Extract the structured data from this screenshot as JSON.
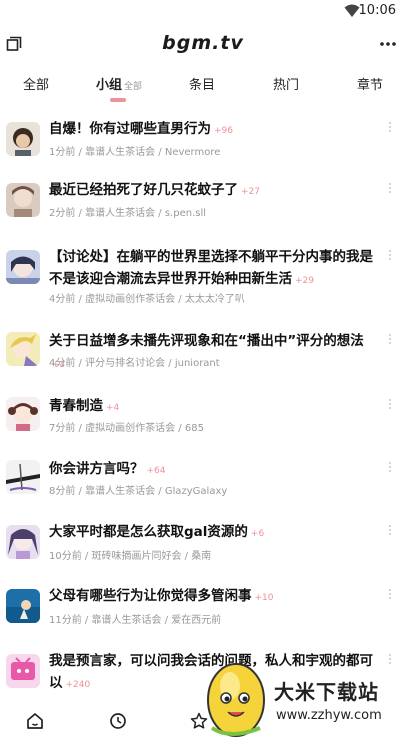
{
  "status_bar": {
    "time": "10:06"
  },
  "app_bar": {
    "logo": "bgm.tv",
    "menu_icon": "menu-list-icon",
    "more_icon": "more-horizontal-icon"
  },
  "tabs": [
    {
      "label": "全部",
      "sub": ""
    },
    {
      "label": "小组",
      "sub": "全部"
    },
    {
      "label": "条目",
      "sub": ""
    },
    {
      "label": "热门",
      "sub": ""
    },
    {
      "label": "章节",
      "sub": ""
    }
  ],
  "active_tab": "小组",
  "accent_color": "#f09199",
  "topics": [
    {
      "title": "自爆！你有过哪些直男行为",
      "replies": "+96",
      "time": "1分前",
      "group": "靠谱人生茶话会",
      "user": "Nevermore"
    },
    {
      "title": "最近已经拍死了好几只花蚊子了",
      "replies": "+27",
      "time": "2分前",
      "group": "靠谱人生茶话会",
      "user": "s.pen.sll"
    },
    {
      "title": "【讨论处】在躺平的世界里选择不躺平干分内事的我是不是该迎合潮流去异世界开始种田新生活",
      "replies": "+29",
      "time": "4分前",
      "group": "虚拟动画创作茶话会",
      "user": "太太太冷了叭"
    },
    {
      "title": "关于日益增多未播先评现象和在“播出中”评分的想法",
      "replies": "+4",
      "time": "4分前",
      "group": "评分与排名讨论会",
      "user": "juniorant"
    },
    {
      "title": "青春制造",
      "replies": "+4",
      "time": "7分前",
      "group": "虚拟动画创作茶话会",
      "user": "685"
    },
    {
      "title": "你会讲方言吗？",
      "replies": "+64",
      "time": "8分前",
      "group": "靠谱人生茶话会",
      "user": "GlazyGalaxy"
    },
    {
      "title": "大家平时都是怎么获取gal资源的",
      "replies": "+6",
      "time": "10分前",
      "group": "斑砖味摘画片同好会",
      "user": "桑南"
    },
    {
      "title": "父母有哪些行为让你觉得多管闲事",
      "replies": "+10",
      "time": "11分前",
      "group": "靠谱人生茶话会",
      "user": "爱在西元前"
    },
    {
      "title": "我是预言家，可以问我会话的问题，私人和宇观的都可以",
      "replies": "+240",
      "time": "",
      "group": "",
      "user": ""
    }
  ],
  "bottom_nav": [
    "home-icon",
    "clock-icon",
    "star-icon"
  ],
  "watermark": {
    "text": "大米下载站",
    "url": "www.zzhyw.com"
  }
}
